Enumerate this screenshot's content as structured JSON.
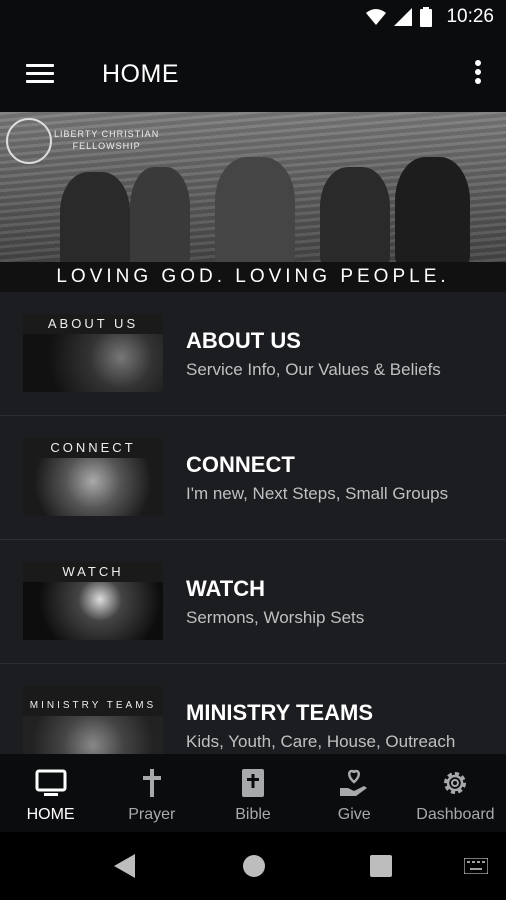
{
  "status_bar": {
    "time": "10:26"
  },
  "app_bar": {
    "title": "HOME"
  },
  "hero": {
    "logo_text_line1": "LIBERTY CHRISTIAN",
    "logo_text_line2": "FELLOWSHIP",
    "tagline": "LOVING GOD.  LOVING PEOPLE."
  },
  "list": [
    {
      "thumb_label": "ABOUT US",
      "title": "ABOUT US",
      "subtitle": "Service Info, Our Values & Beliefs"
    },
    {
      "thumb_label": "CONNECT",
      "title": "CONNECT",
      "subtitle": "I'm new, Next Steps, Small Groups"
    },
    {
      "thumb_label": "WATCH",
      "title": "WATCH",
      "subtitle": "Sermons, Worship Sets"
    },
    {
      "thumb_label": "MINISTRY TEAMS",
      "title": "MINISTRY TEAMS",
      "subtitle": "Kids, Youth, Care, House, Outreach"
    }
  ],
  "bottom_nav": [
    {
      "label": "HOME",
      "icon": "tv-icon",
      "active": true
    },
    {
      "label": "Prayer",
      "icon": "cross-icon"
    },
    {
      "label": "Bible",
      "icon": "bible-icon"
    },
    {
      "label": "Give",
      "icon": "give-hand-icon"
    },
    {
      "label": "Dashboard",
      "icon": "gear-icon"
    }
  ]
}
